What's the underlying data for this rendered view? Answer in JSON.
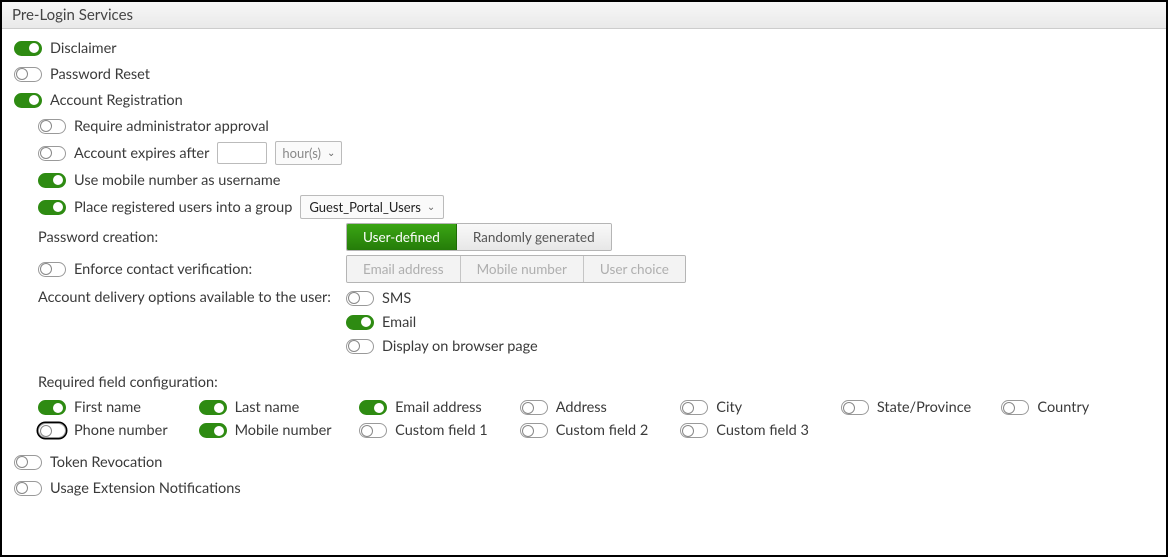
{
  "header": {
    "title": "Pre-Login Services"
  },
  "items": {
    "disclaimer": {
      "label": "Disclaimer",
      "on": true
    },
    "password_reset": {
      "label": "Password Reset",
      "on": false
    },
    "account_registration": {
      "label": "Account Registration",
      "on": true
    },
    "token_revocation": {
      "label": "Token Revocation",
      "on": false
    },
    "usage_ext_notif": {
      "label": "Usage Extension Notifications",
      "on": false
    }
  },
  "account_registration": {
    "require_admin_approval": {
      "label": "Require administrator approval",
      "on": false
    },
    "account_expires": {
      "label": "Account expires after",
      "on": false,
      "value": "",
      "unit": "hour(s)"
    },
    "use_mobile_as_username": {
      "label": "Use mobile number as username",
      "on": true
    },
    "place_in_group": {
      "label": "Place registered users into a group",
      "on": true,
      "selected": "Guest_Portal_Users"
    },
    "password_creation": {
      "label": "Password creation:",
      "options": [
        "User-defined",
        "Randomly generated"
      ],
      "selected": "User-defined"
    },
    "enforce_contact_verification": {
      "label": "Enforce contact verification:",
      "on": false,
      "options": [
        "Email address",
        "Mobile number",
        "User choice"
      ]
    },
    "delivery": {
      "label": "Account delivery options available to the user:",
      "sms": {
        "label": "SMS",
        "on": false
      },
      "email": {
        "label": "Email",
        "on": true
      },
      "browser": {
        "label": "Display on browser page",
        "on": false
      }
    },
    "required_fields": {
      "label": "Required field configuration:",
      "fields": [
        {
          "key": "first_name",
          "label": "First name",
          "on": true
        },
        {
          "key": "last_name",
          "label": "Last name",
          "on": true
        },
        {
          "key": "email_address",
          "label": "Email address",
          "on": true
        },
        {
          "key": "address",
          "label": "Address",
          "on": false
        },
        {
          "key": "city",
          "label": "City",
          "on": false
        },
        {
          "key": "state",
          "label": "State/Province",
          "on": false
        },
        {
          "key": "country",
          "label": "Country",
          "on": false
        },
        {
          "key": "phone_number",
          "label": "Phone number",
          "on": false,
          "focus": true
        },
        {
          "key": "mobile_number",
          "label": "Mobile number",
          "on": true
        },
        {
          "key": "custom1",
          "label": "Custom field 1",
          "on": false
        },
        {
          "key": "custom2",
          "label": "Custom field 2",
          "on": false
        },
        {
          "key": "custom3",
          "label": "Custom field 3",
          "on": false
        }
      ]
    }
  }
}
